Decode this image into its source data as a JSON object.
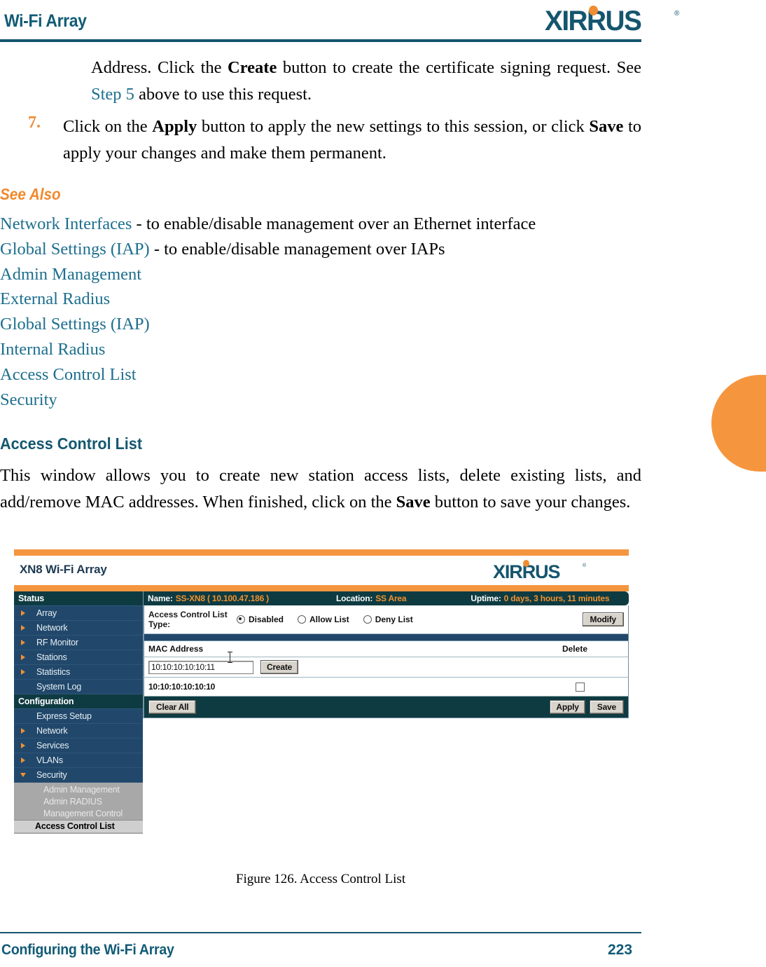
{
  "header": {
    "title": "Wi-Fi Array",
    "logo": "XIRRUS",
    "logo_reg": "®"
  },
  "intro": {
    "before_bold": "Address.  Click  the  ",
    "bold": "Create",
    "after_bold": "  button  to  create  the  certificate  signing request. See ",
    "link": "Step 5",
    "tail": " above to use this request."
  },
  "step": {
    "number": "7.",
    "part1": "Click  on  the  ",
    "bold1": "Apply",
    "part2": "  button  to  apply  the  new  settings  to  this  session,  or click ",
    "bold2": "Save",
    "part3": " to apply your changes and make them permanent."
  },
  "see_also": {
    "heading": "See Also",
    "items": [
      {
        "link": "Network Interfaces",
        "desc": " - to enable/disable management over an Ethernet interface"
      },
      {
        "link": "Global Settings (IAP)",
        "desc": " - to enable/disable management over IAPs"
      },
      {
        "link": "Admin Management",
        "desc": ""
      },
      {
        "link": "External Radius",
        "desc": ""
      },
      {
        "link": "Global Settings (IAP)",
        "desc": ""
      },
      {
        "link": "Internal Radius",
        "desc": ""
      },
      {
        "link": "Access Control List",
        "desc": ""
      },
      {
        "link": "Security",
        "desc": ""
      }
    ]
  },
  "section": {
    "heading": "Access Control List",
    "body_1": "This  window  allows  you  to  create  new  station  access  lists,  delete  existing  lists, and  add/remove  MAC  addresses.  When  finished,  click  on  the  ",
    "body_bold": "Save",
    "body_2": "  button  to save your changes."
  },
  "figure": {
    "caption": "Figure 126. Access Control List",
    "app": {
      "title": "XN8 Wi-Fi Array",
      "logo": "XIRRUS",
      "logo_reg": "®",
      "info_bar": {
        "name_label": "Name:",
        "name_value": "SS-XN8   ( 10.100.47.186 )",
        "location_label": "Location:",
        "location_value": "SS Area",
        "uptime_label": "Uptime:",
        "uptime_value": "0 days, 3 hours, 11 minutes"
      },
      "sidebar": {
        "sections": [
          {
            "header": "Status",
            "items": [
              {
                "label": "Array",
                "arrow": "right"
              },
              {
                "label": "Network",
                "arrow": "right"
              },
              {
                "label": "RF Monitor",
                "arrow": "right"
              },
              {
                "label": "Stations",
                "arrow": "right"
              },
              {
                "label": "Statistics",
                "arrow": "right"
              },
              {
                "label": "System Log",
                "arrow": "none"
              }
            ]
          },
          {
            "header": "Configuration",
            "items": [
              {
                "label": "Express Setup",
                "arrow": "none"
              },
              {
                "label": "Network",
                "arrow": "right"
              },
              {
                "label": "Services",
                "arrow": "right"
              },
              {
                "label": "VLANs",
                "arrow": "right"
              },
              {
                "label": "Security",
                "arrow": "down"
              }
            ]
          }
        ],
        "submenu": [
          {
            "label": "Admin Management",
            "current": false
          },
          {
            "label": "Admin RADIUS",
            "current": false
          },
          {
            "label": "Management Control",
            "current": false
          },
          {
            "label": "Access Control List",
            "current": true
          }
        ]
      },
      "acl_type": {
        "label_line1": "Access Control List",
        "label_line2": "Type:",
        "options": [
          {
            "label": "Disabled",
            "selected": true
          },
          {
            "label": "Allow List",
            "selected": false
          },
          {
            "label": "Deny List",
            "selected": false
          }
        ],
        "modify_button": "Modify"
      },
      "table": {
        "col_mac": "MAC Address",
        "col_delete": "Delete",
        "new_mac_value": "10:10:10:10:10:11",
        "create_button": "Create",
        "rows": [
          {
            "mac": "10:10:10:10:10:10",
            "delete_checked": false
          }
        ]
      },
      "actions": {
        "clear_all": "Clear All",
        "apply": "Apply",
        "save": "Save"
      }
    }
  },
  "footer": {
    "left": "Configuring the Wi-Fi Array",
    "page": "223"
  },
  "colors": {
    "brand_teal": "#15556e",
    "brand_orange": "#f1892c",
    "link_teal": "#1d6f8e",
    "nav_navy": "#21486b",
    "nav_dark": "#0e3b41"
  }
}
